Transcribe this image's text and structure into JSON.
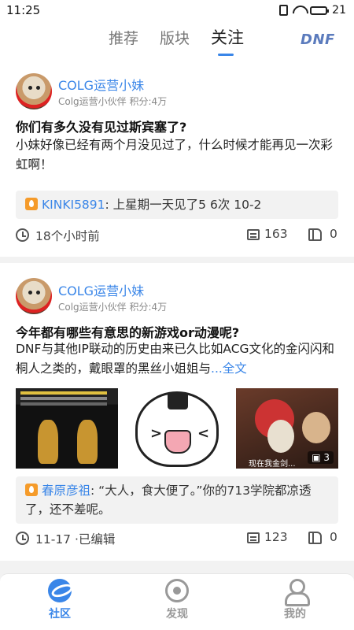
{
  "status_bar": {
    "time": "11:25",
    "battery": "21"
  },
  "top_nav": {
    "tabs": [
      {
        "label": "推荐",
        "active": false
      },
      {
        "label": "版块",
        "active": false
      },
      {
        "label": "关注",
        "active": true
      }
    ],
    "logo": "DNF"
  },
  "posts": [
    {
      "author": "COLG运营小妹",
      "meta": "Colg运营小伙伴  积分:4万",
      "title": "你们有多久没有见过斯宾塞了?",
      "body": "小妹好像已经有两个月没见过了，什么时候才能再见一次彩虹啊！",
      "comment_user": "KINKI5891",
      "comment_text": ": 上星期一天见了5 6次 10-2",
      "time": "18个小时前",
      "comment_count": "163",
      "like_count": "0"
    },
    {
      "author": "COLG运营小妹",
      "meta": "Colg运营小伙伴  积分:4万",
      "title": "今年都有哪些有意思的新游戏or动漫呢?",
      "body": " DNF与其他IP联动的历史由来已久比如ACG文化的金闪闪和桐人之类的，戴眼罩的黑丝小姐姐与",
      "more": "...全文",
      "images": [
        "game-screenshot",
        "onigiri-sticker",
        "tv-drama-still"
      ],
      "image_count_badge": "3",
      "image_caption": "现在我金剑...",
      "comment_user": "春原彦祖",
      "comment_text": ": “大人，食大便了。”你的713学院都凉透了，还不差呢。",
      "time": "11-17 ·已编辑",
      "comment_count": "123",
      "like_count": "0"
    }
  ],
  "bottom_bar": [
    {
      "label": "社区",
      "icon": "community-planet-icon",
      "active": true
    },
    {
      "label": "发现",
      "icon": "discover-icon",
      "active": false
    },
    {
      "label": "我的",
      "icon": "profile-icon",
      "active": false
    }
  ],
  "colors": {
    "accent": "#3a86e8",
    "fire": "#f59b2a"
  }
}
